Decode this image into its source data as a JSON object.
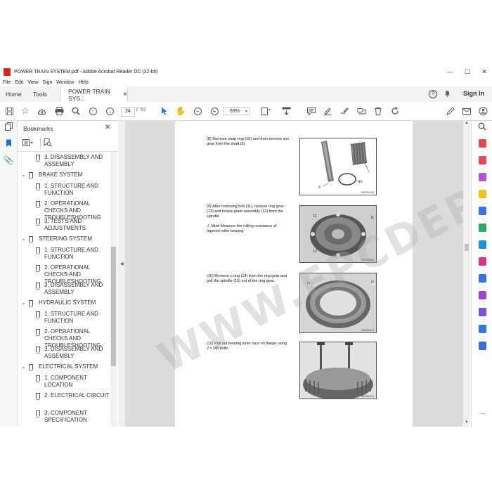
{
  "window": {
    "title": "POWER TRAIN SYSTEM.pdf - Adobe Acrobat Reader DC (32-bit)",
    "controls": {
      "minimize": "—",
      "maximize": "☐",
      "close": "✕"
    }
  },
  "menu": [
    "File",
    "Edit",
    "View",
    "Sign",
    "Window",
    "Help"
  ],
  "tabs": {
    "home": "Home",
    "tools": "Tools",
    "document": "POWER TRAIN SYS...",
    "close": "×"
  },
  "header_right": {
    "help": "?",
    "sign_in": "Sign In"
  },
  "toolbar": {
    "page_current": "24",
    "page_sep": "/",
    "page_total": "57",
    "zoom": "69%"
  },
  "bookmarks": {
    "title": "Bookmarks",
    "close": "✕",
    "items": [
      {
        "level": 2,
        "label": "3. DISASSEMBLY AND ASSEMBLY"
      },
      {
        "level": 1,
        "label": "BRAKE SYSTEM"
      },
      {
        "level": 2,
        "label": "1. STRUCTURE AND FUNCTION"
      },
      {
        "level": 2,
        "label": "2. OPERATIONAL CHECKS AND TROUBLESHOOTING"
      },
      {
        "level": 2,
        "label": "3. TESTS AND ADJUSTMENTS"
      },
      {
        "level": 1,
        "label": "STEERING SYSTEM"
      },
      {
        "level": 2,
        "label": "1. STRUCTURE AND FUNCTION"
      },
      {
        "level": 2,
        "label": "2. OPERATIONAL CHECKS AND TROUBLESHOOTING"
      },
      {
        "level": 2,
        "label": "3. DISASSEMBLY AND ASSEMBLY"
      },
      {
        "level": 1,
        "label": "HYDRAULIC SYSTEM"
      },
      {
        "level": 2,
        "label": "1. STRUCTURE AND FUNCTION"
      },
      {
        "level": 2,
        "label": "2. OPERATIONAL CHECKS AND TROUBLESHOOTING"
      },
      {
        "level": 2,
        "label": "3. DISASSEMBLY AND ASSEMBLY"
      },
      {
        "level": 1,
        "label": "ELECTRICAL SYSTEM"
      },
      {
        "level": 2,
        "label": "1. COMPONENT LOCATION"
      },
      {
        "level": 2,
        "label": "2. ELECTRICAL CIRCUIT"
      },
      {
        "level": 2,
        "label": "3. COMPONENT SPECIFICATION"
      }
    ]
  },
  "document": {
    "watermark": "WWW.EPCDEPO.COM",
    "steps": [
      {
        "text": "(8) Remove snap ring (10) and then remove sun gear from the shaft (9).",
        "callouts": [
          "9",
          "10"
        ],
        "code": "3820B0A08"
      },
      {
        "text": "(9) After removing bolt (11), remove ring gear (13) and torque plate assembly (12) from the spindle.",
        "warning": "⚠ Must Measure the rolling resistance of tapered roller bearing.",
        "callouts": [
          "12",
          "11",
          "13"
        ],
        "code": "3820B0A09"
      },
      {
        "text": "(10) Remove c-ring (14) from the ring gear and pull the spindle (15) out of the ring gear.",
        "callouts": [
          "14",
          "15"
        ],
        "code": "3820B0A10"
      },
      {
        "text": "(11) Pull out bearing inner race on flange using 2 × M8 bolts.",
        "callouts": [],
        "code": "3820B0A11"
      }
    ]
  }
}
